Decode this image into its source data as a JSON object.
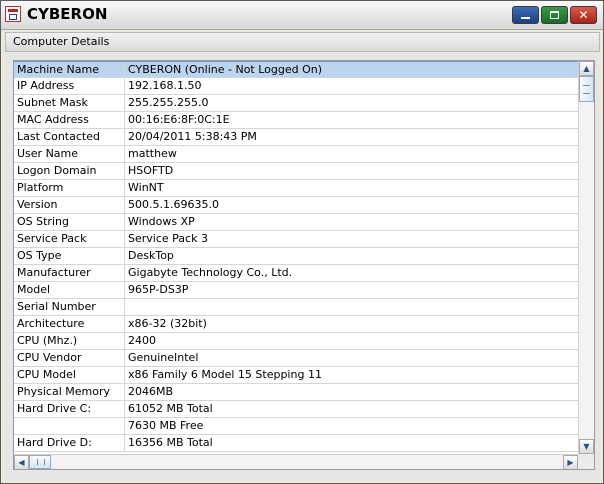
{
  "window": {
    "title": "CYBERON"
  },
  "group": {
    "label": "Computer Details"
  },
  "rows": [
    {
      "k": "Machine Name",
      "v": "CYBERON (Online - Not Logged On)"
    },
    {
      "k": "IP Address",
      "v": "192.168.1.50"
    },
    {
      "k": "Subnet Mask",
      "v": "255.255.255.0"
    },
    {
      "k": "MAC Address",
      "v": "00:16:E6:8F:0C:1E"
    },
    {
      "k": "Last Contacted",
      "v": "20/04/2011 5:38:43 PM"
    },
    {
      "k": "User Name",
      "v": "matthew"
    },
    {
      "k": "Logon Domain",
      "v": "HSOFTD"
    },
    {
      "k": "Platform",
      "v": "WinNT"
    },
    {
      "k": "Version",
      "v": "500.5.1.69635.0"
    },
    {
      "k": "OS String",
      "v": "Windows XP"
    },
    {
      "k": "Service Pack",
      "v": "Service Pack 3"
    },
    {
      "k": "OS Type",
      "v": "DeskTop"
    },
    {
      "k": "Manufacturer",
      "v": "Gigabyte Technology Co., Ltd."
    },
    {
      "k": "Model",
      "v": "965P-DS3P"
    },
    {
      "k": "Serial Number",
      "v": ""
    },
    {
      "k": "Architecture",
      "v": "x86-32 (32bit)"
    },
    {
      "k": "CPU (Mhz.)",
      "v": "2400"
    },
    {
      "k": "CPU Vendor",
      "v": "GenuineIntel"
    },
    {
      "k": "CPU Model",
      "v": "x86 Family 6 Model 15 Stepping 11"
    },
    {
      "k": "Physical Memory",
      "v": "2046MB"
    },
    {
      "k": "Hard Drive C:",
      "v": "61052 MB Total"
    },
    {
      "k": "",
      "v": "7630 MB Free"
    },
    {
      "k": "Hard Drive D:",
      "v": "16356 MB Total"
    }
  ],
  "selected_row": 0,
  "icons": {
    "app": "network-computer-icon",
    "minimize": "minimize-icon",
    "maximize": "maximize-icon",
    "close": "close-icon",
    "scroll_up": "chevron-up-icon",
    "scroll_down": "chevron-down-icon",
    "scroll_left": "chevron-left-icon",
    "scroll_right": "chevron-right-icon"
  },
  "colors": {
    "selection": "#bcd4ee",
    "minimize_button": "#2a55a0",
    "maximize_button": "#2a8a38",
    "close_button": "#c03a2c"
  }
}
